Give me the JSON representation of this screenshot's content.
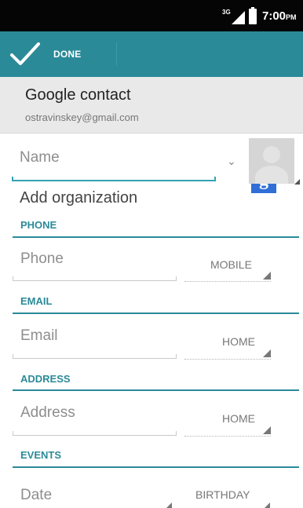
{
  "status_bar": {
    "network": "3G",
    "time": "7:00",
    "ampm": "PM"
  },
  "action_bar": {
    "done_label": "DONE",
    "accent_color": "#2b8a98"
  },
  "account": {
    "title": "Google contact",
    "email": "ostravinskey@gmail.com",
    "icon_letter": "g"
  },
  "form": {
    "name_placeholder": "Name",
    "add_organization": "Add organization",
    "sections": {
      "phone": {
        "header": "PHONE",
        "placeholder": "Phone",
        "type": "MOBILE"
      },
      "email": {
        "header": "EMAIL",
        "placeholder": "Email",
        "type": "HOME"
      },
      "address": {
        "header": "ADDRESS",
        "placeholder": "Address",
        "type": "HOME"
      },
      "events": {
        "header": "EVENTS",
        "placeholder": "Date",
        "type": "BIRTHDAY"
      }
    }
  }
}
